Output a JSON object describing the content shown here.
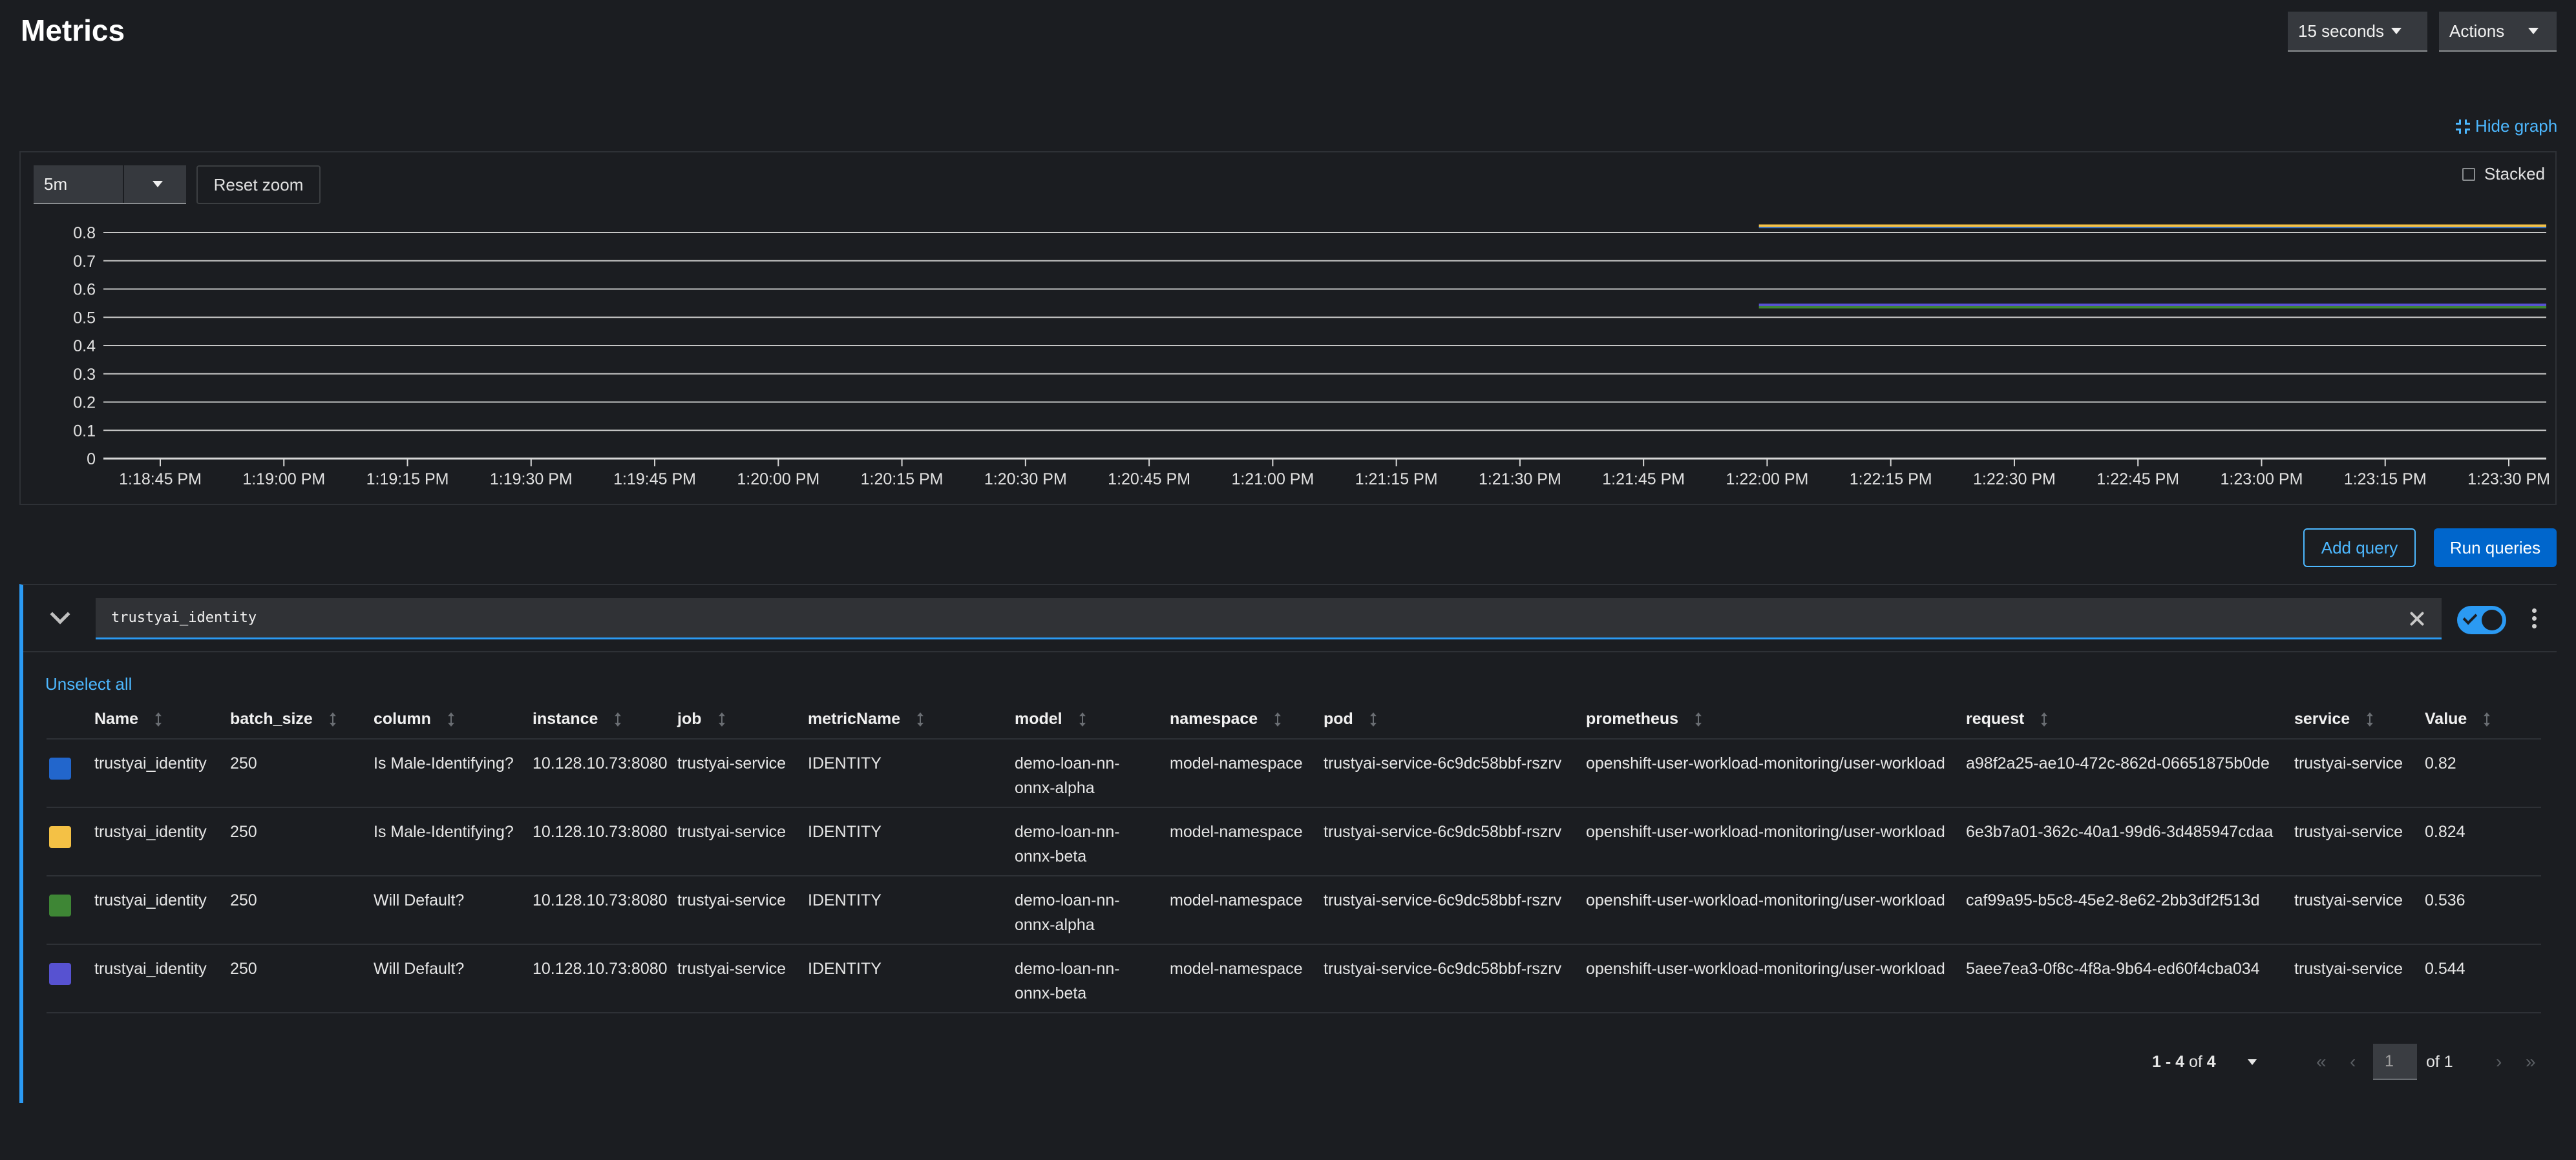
{
  "page": {
    "title": "Metrics"
  },
  "toolbar": {
    "interval": "15 seconds",
    "actions": "Actions"
  },
  "graph": {
    "hide_graph_label": "Hide graph",
    "range": "5m",
    "reset_zoom_label": "Reset zoom",
    "stacked_label": "Stacked"
  },
  "chart_data": {
    "type": "line",
    "y_ticks": [
      "0",
      "0.1",
      "0.2",
      "0.3",
      "0.4",
      "0.5",
      "0.6",
      "0.7",
      "0.8"
    ],
    "ylim": [
      0,
      0.8
    ],
    "x_ticks": [
      "1:18:45 PM",
      "1:19:00 PM",
      "1:19:15 PM",
      "1:19:30 PM",
      "1:19:45 PM",
      "1:20:00 PM",
      "1:20:15 PM",
      "1:20:30 PM",
      "1:20:45 PM",
      "1:21:00 PM",
      "1:21:15 PM",
      "1:21:30 PM",
      "1:21:45 PM",
      "1:22:00 PM",
      "1:22:15 PM",
      "1:22:30 PM",
      "1:22:45 PM",
      "1:23:00 PM",
      "1:23:15 PM",
      "1:23:30 PM"
    ],
    "series": [
      {
        "color": "#2266cc",
        "start_time": "1:21:59 PM",
        "end_time": "1:23:38 PM",
        "value": 0.82
      },
      {
        "color": "#f4c145",
        "start_time": "1:21:59 PM",
        "end_time": "1:23:38 PM",
        "value": 0.824
      },
      {
        "color": "#3e8635",
        "start_time": "1:21:59 PM",
        "end_time": "1:23:38 PM",
        "value": 0.536
      },
      {
        "color": "#5752d1",
        "start_time": "1:21:59 PM",
        "end_time": "1:23:38 PM",
        "value": 0.544
      }
    ]
  },
  "buttons": {
    "add_query": "Add query",
    "run_queries": "Run queries"
  },
  "query": {
    "expression": "trustyai_identity",
    "unselect_all": "Unselect all",
    "columns": [
      "Name",
      "batch_size",
      "column",
      "instance",
      "job",
      "metricName",
      "model",
      "namespace",
      "pod",
      "prometheus",
      "request",
      "service",
      "Value"
    ],
    "rows": [
      {
        "color": "#2266cc",
        "cells": [
          "trustyai_identity",
          "250",
          "Is Male-Identifying?",
          "10.128.10.73:8080",
          "trustyai-service",
          "IDENTITY",
          "demo-loan-nn-onnx-alpha",
          "model-namespace",
          "trustyai-service-6c9dc58bbf-rszrv",
          "openshift-user-workload-monitoring/user-workload",
          "a98f2a25-ae10-472c-862d-06651875b0de",
          "trustyai-service",
          "0.82"
        ]
      },
      {
        "color": "#f4c145",
        "cells": [
          "trustyai_identity",
          "250",
          "Is Male-Identifying?",
          "10.128.10.73:8080",
          "trustyai-service",
          "IDENTITY",
          "demo-loan-nn-onnx-beta",
          "model-namespace",
          "trustyai-service-6c9dc58bbf-rszrv",
          "openshift-user-workload-monitoring/user-workload",
          "6e3b7a01-362c-40a1-99d6-3d485947cdaa",
          "trustyai-service",
          "0.824"
        ]
      },
      {
        "color": "#3e8635",
        "cells": [
          "trustyai_identity",
          "250",
          "Will Default?",
          "10.128.10.73:8080",
          "trustyai-service",
          "IDENTITY",
          "demo-loan-nn-onnx-alpha",
          "model-namespace",
          "trustyai-service-6c9dc58bbf-rszrv",
          "openshift-user-workload-monitoring/user-workload",
          "caf99a95-b5c8-45e2-8e62-2bb3df2f513d",
          "trustyai-service",
          "0.536"
        ]
      },
      {
        "color": "#5752d1",
        "cells": [
          "trustyai_identity",
          "250",
          "Will Default?",
          "10.128.10.73:8080",
          "trustyai-service",
          "IDENTITY",
          "demo-loan-nn-onnx-beta",
          "model-namespace",
          "trustyai-service-6c9dc58bbf-rszrv",
          "openshift-user-workload-monitoring/user-workload",
          "5aee7ea3-0f8c-4f8a-9b64-ed60f4cba034",
          "trustyai-service",
          "0.544"
        ]
      }
    ]
  },
  "pagination": {
    "range": "1 - 4",
    "of_label": "of",
    "total": "4",
    "page": "1",
    "pages_label": "of 1"
  }
}
